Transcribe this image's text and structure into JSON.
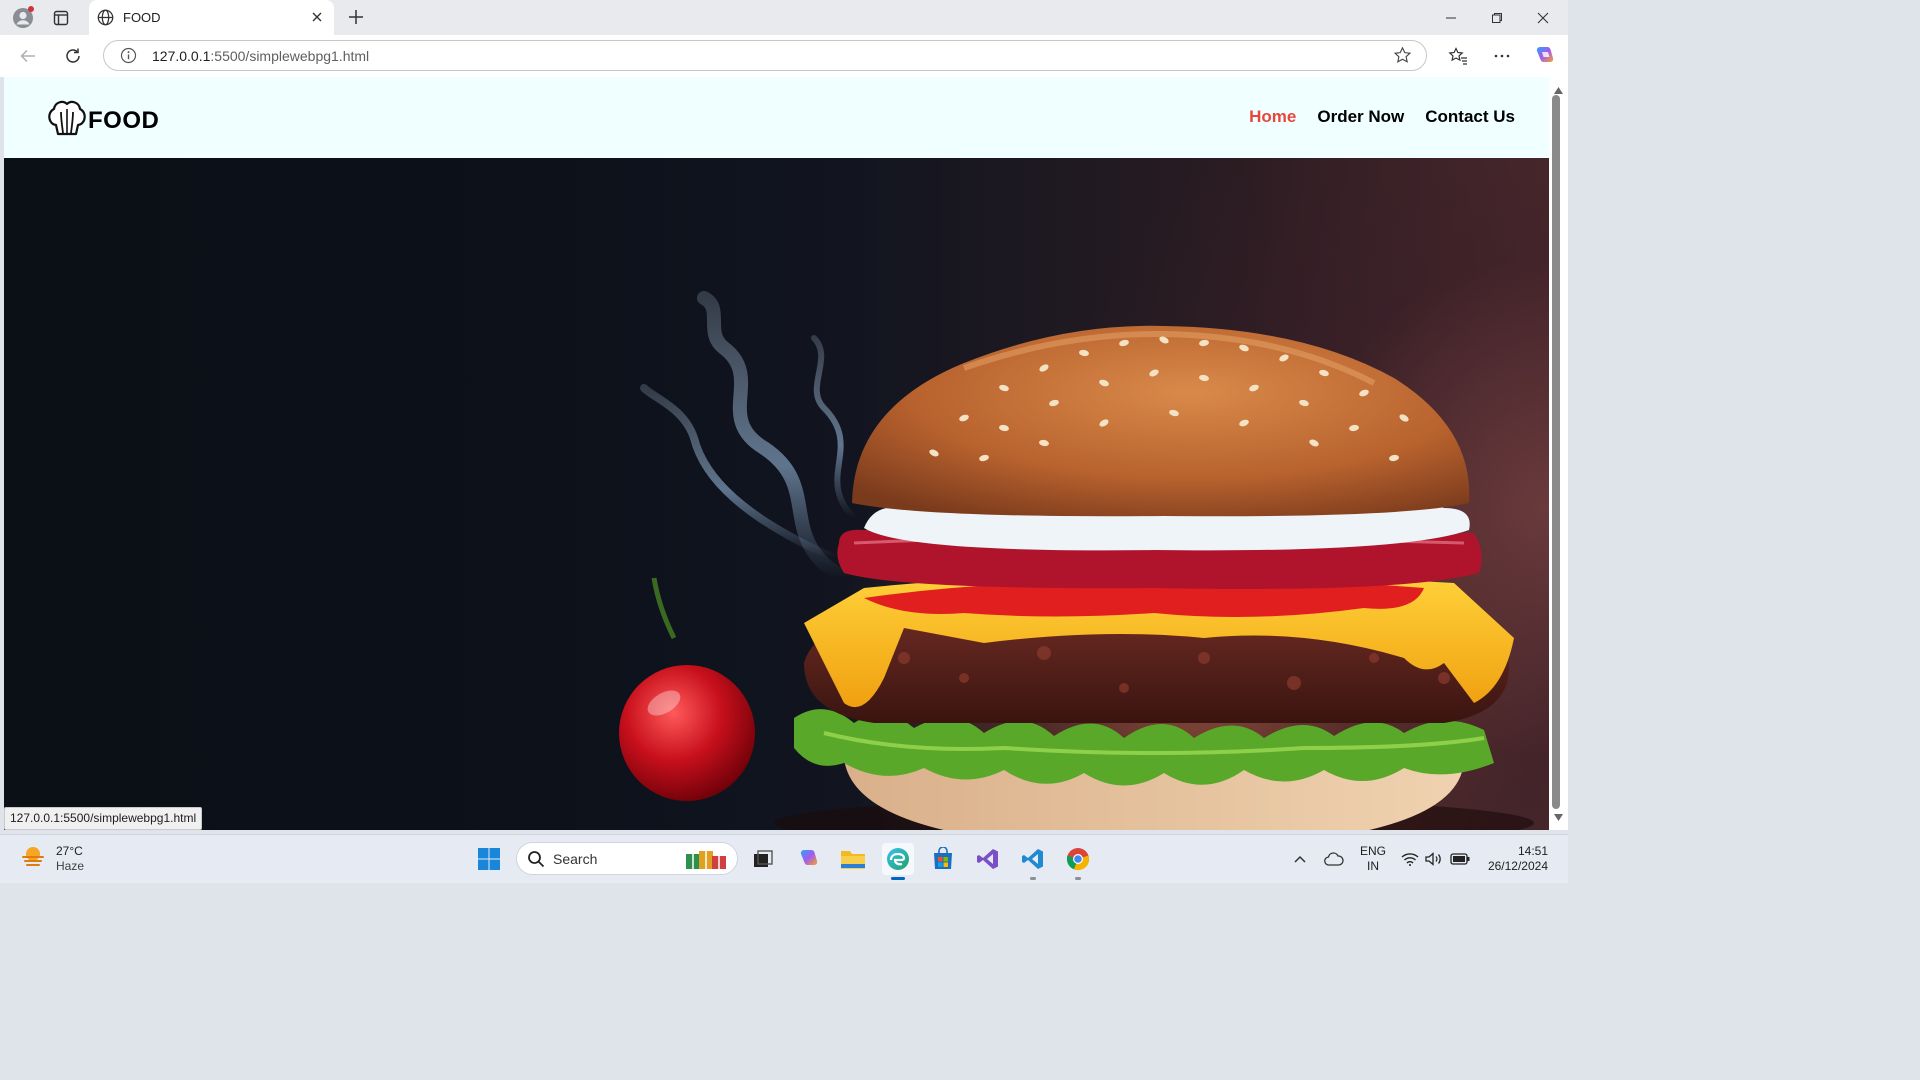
{
  "browser": {
    "tab_title": "FOOD",
    "url_host": "127.0.0.1",
    "url_rest": ":5500/simplewebpg1.html",
    "status_url": "127.0.0.1:5500/simplewebpg1.html"
  },
  "site": {
    "logo_text": "FOOD",
    "nav": [
      {
        "label": "Home",
        "active": true
      },
      {
        "label": "Order Now",
        "active": false
      },
      {
        "label": "Contact Us",
        "active": false
      }
    ],
    "hero_image": "burger-hero-image",
    "accent_color": "#e7473c",
    "header_bg": "#f0ffff"
  },
  "taskbar": {
    "weather": {
      "temp": "27°C",
      "condition": "Haze"
    },
    "search_label": "Search",
    "lang": {
      "line1": "ENG",
      "line2": "IN"
    },
    "clock": {
      "time": "14:51",
      "date": "26/12/2024"
    }
  }
}
